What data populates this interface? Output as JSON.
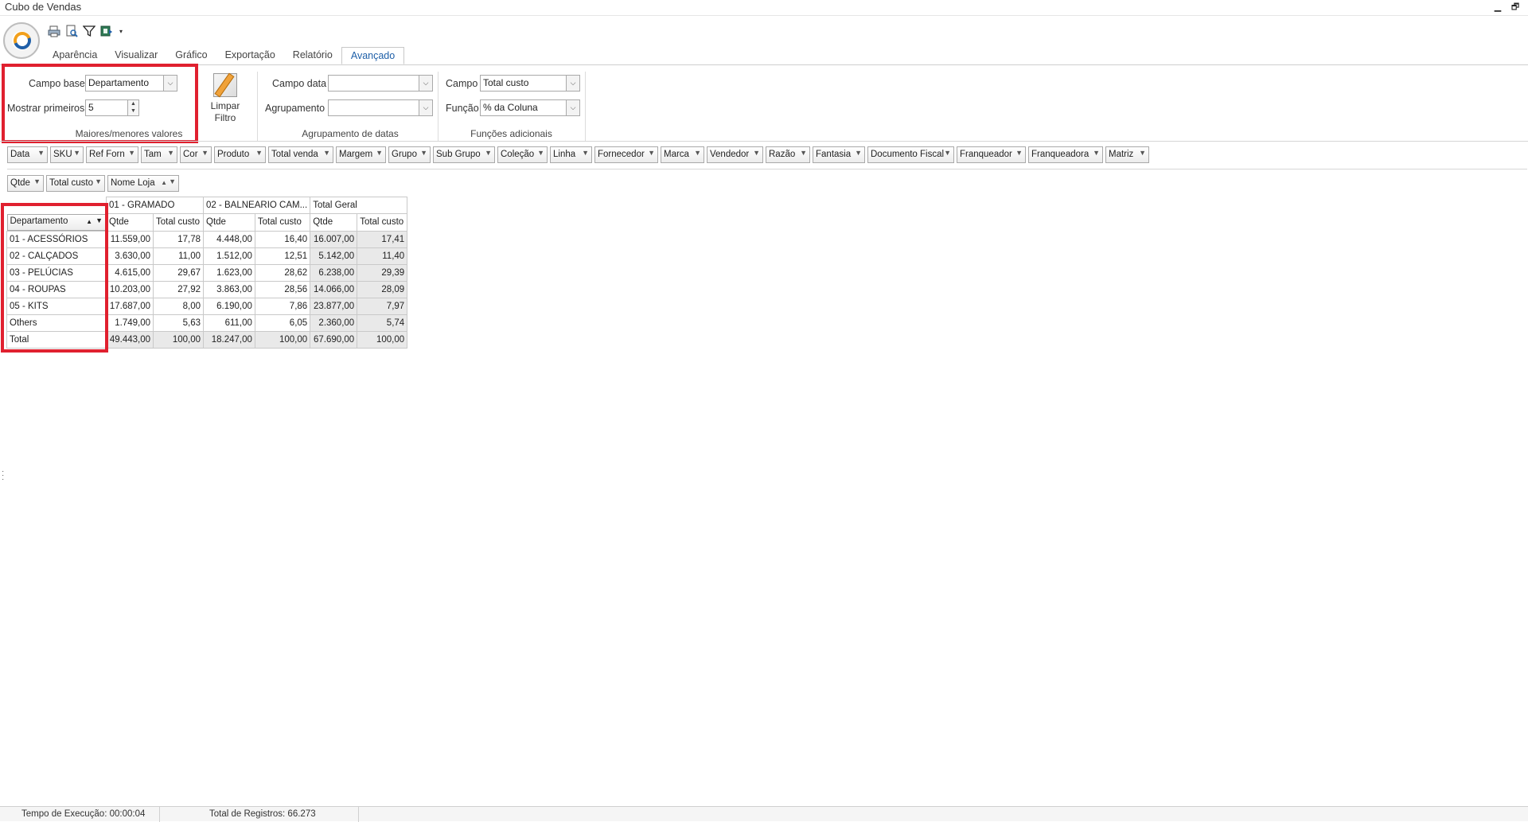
{
  "window": {
    "title": "Cubo de Vendas",
    "minimize": "▁",
    "restore": "🗗"
  },
  "qat": [
    "print-icon",
    "preview-icon",
    "filter-icon",
    "export-icon"
  ],
  "tabs": [
    "Aparência",
    "Visualizar",
    "Gráfico",
    "Exportação",
    "Relatório",
    "Avançado"
  ],
  "active_tab": "Avançado",
  "ribbon": {
    "topn": {
      "campo_base_label": "Campo base",
      "campo_base_value": "Departamento",
      "mostrar_label": "Mostrar primeiros",
      "mostrar_value": "5",
      "caption": "Maiores/menores valores"
    },
    "limpar": {
      "line1": "Limpar",
      "line2": "Filtro"
    },
    "datas": {
      "campo_data_label": "Campo data",
      "campo_data_value": "",
      "agrupamento_label": "Agrupamento",
      "agrupamento_value": "",
      "caption": "Agrupamento de datas"
    },
    "funcoes": {
      "campo_label": "Campo",
      "campo_value": "Total custo",
      "funcao_label": "Função",
      "funcao_value": "% da Coluna",
      "caption": "Funções adicionais"
    }
  },
  "filter_fields": [
    "Data",
    "SKU",
    "Ref Forn",
    "Tam",
    "Cor",
    "Produto",
    "Total venda",
    "Margem",
    "Grupo",
    "Sub Grupo",
    "Coleção",
    "Linha",
    "Fornecedor",
    "Marca",
    "Vendedor",
    "Razão",
    "Fantasia",
    "Documento Fiscal",
    "Franqueador",
    "Franqueadora",
    "Matriz"
  ],
  "data_fields": [
    "Qtde",
    "Total custo"
  ],
  "column_field": "Nome Loja",
  "row_field": "Departamento",
  "pivot": {
    "col_groups": [
      "01 - GRAMADO",
      "02 - BALNEARIO CAM...",
      "Total Geral"
    ],
    "measures": [
      "Qtde",
      "Total custo"
    ],
    "rows": [
      {
        "label": "01 - ACESSÓRIOS",
        "v": [
          "11.559,00",
          "17,78",
          "4.448,00",
          "16,40",
          "16.007,00",
          "17,41"
        ]
      },
      {
        "label": "02 - CALÇADOS",
        "v": [
          "3.630,00",
          "11,00",
          "1.512,00",
          "12,51",
          "5.142,00",
          "11,40"
        ]
      },
      {
        "label": "03 - PELÚCIAS",
        "v": [
          "4.615,00",
          "29,67",
          "1.623,00",
          "28,62",
          "6.238,00",
          "29,39"
        ]
      },
      {
        "label": "04 - ROUPAS",
        "v": [
          "10.203,00",
          "27,92",
          "3.863,00",
          "28,56",
          "14.066,00",
          "28,09"
        ]
      },
      {
        "label": "05 - KITS",
        "v": [
          "17.687,00",
          "8,00",
          "6.190,00",
          "7,86",
          "23.877,00",
          "7,97"
        ]
      },
      {
        "label": "Others",
        "v": [
          "1.749,00",
          "5,63",
          "611,00",
          "6,05",
          "2.360,00",
          "5,74"
        ]
      },
      {
        "label": "Total",
        "v": [
          "49.443,00",
          "100,00",
          "18.247,00",
          "100,00",
          "67.690,00",
          "100,00"
        ]
      }
    ]
  },
  "status": {
    "tempo": "Tempo de Execução: 00:00:04",
    "registros": "Total de Registros: 66.273"
  },
  "colors": {
    "highlight": "#e0202f",
    "active_tab": "#1e5fa8"
  }
}
